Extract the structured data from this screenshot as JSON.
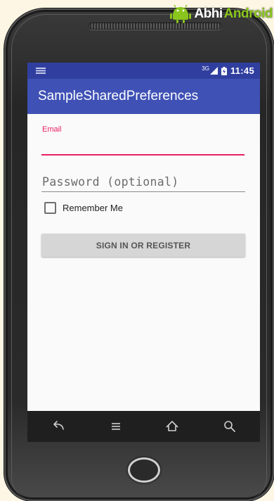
{
  "watermark": {
    "part1": "Abhi",
    "part2": "Android"
  },
  "status_bar": {
    "network": "3G",
    "time": "11:45"
  },
  "app_bar": {
    "title": "SampleSharedPreferences"
  },
  "form": {
    "email_label": "Email",
    "email_value": "",
    "password_placeholder": "Password (optional)",
    "remember_label": "Remember Me",
    "remember_checked": false,
    "signin_label": "SIGN IN OR REGISTER"
  },
  "nav_bar": {
    "icons": [
      "back-icon",
      "menu-icon",
      "home-icon",
      "search-icon"
    ]
  },
  "colors": {
    "primary": "#3f51b5",
    "primary_dark": "#303f9f",
    "accent": "#e91e63"
  }
}
